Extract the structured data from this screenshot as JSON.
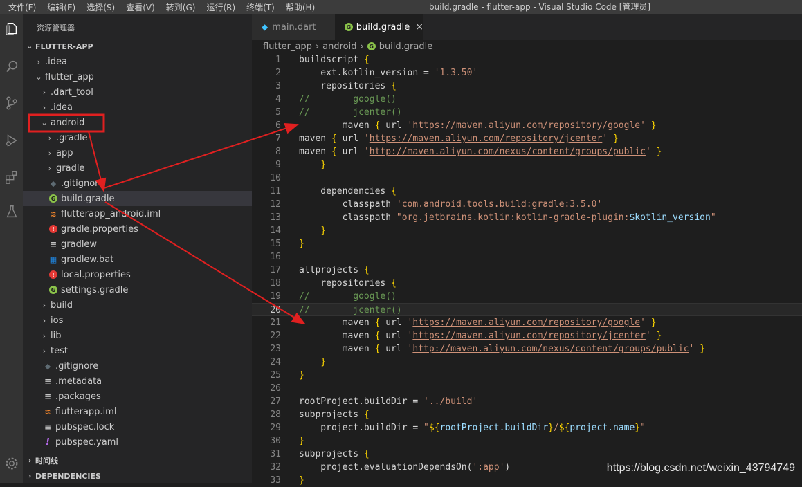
{
  "menu": [
    "文件(F)",
    "编辑(E)",
    "选择(S)",
    "查看(V)",
    "转到(G)",
    "运行(R)",
    "终端(T)",
    "帮助(H)"
  ],
  "window_title": "build.gradle - flutter-app - Visual Studio Code [管理员]",
  "sidebar": {
    "title": "资源管理器",
    "root": "FLUTTER-APP",
    "timeline": "时间线",
    "dependencies": "DEPENDENCIES",
    "tree": [
      {
        "label": ".idea",
        "type": "folder",
        "depth": 0,
        "chev": "›"
      },
      {
        "label": "flutter_app",
        "type": "folder",
        "depth": 0,
        "chev": "⌄"
      },
      {
        "label": ".dart_tool",
        "type": "folder",
        "depth": 1,
        "chev": "›"
      },
      {
        "label": ".idea",
        "type": "folder",
        "depth": 1,
        "chev": "›"
      },
      {
        "label": "android",
        "type": "folder",
        "depth": 1,
        "chev": "⌄"
      },
      {
        "label": ".gradle",
        "type": "folder",
        "depth": 2,
        "chev": "›"
      },
      {
        "label": "app",
        "type": "folder",
        "depth": 2,
        "chev": "›"
      },
      {
        "label": "gradle",
        "type": "folder",
        "depth": 2,
        "chev": "›"
      },
      {
        "label": ".gitignore",
        "type": "git",
        "depth": 2
      },
      {
        "label": "build.gradle",
        "type": "gradle",
        "depth": 2,
        "selected": true
      },
      {
        "label": "flutterapp_android.iml",
        "type": "xml",
        "depth": 2
      },
      {
        "label": "gradle.properties",
        "type": "prop",
        "depth": 2
      },
      {
        "label": "gradlew",
        "type": "lines",
        "depth": 2
      },
      {
        "label": "gradlew.bat",
        "type": "win",
        "depth": 2
      },
      {
        "label": "local.properties",
        "type": "prop",
        "depth": 2
      },
      {
        "label": "settings.gradle",
        "type": "gradle",
        "depth": 2
      },
      {
        "label": "build",
        "type": "folder",
        "depth": 1,
        "chev": "›"
      },
      {
        "label": "ios",
        "type": "folder",
        "depth": 1,
        "chev": "›"
      },
      {
        "label": "lib",
        "type": "folder",
        "depth": 1,
        "chev": "›"
      },
      {
        "label": "test",
        "type": "folder",
        "depth": 1,
        "chev": "›"
      },
      {
        "label": ".gitignore",
        "type": "git",
        "depth": 1
      },
      {
        "label": ".metadata",
        "type": "lines",
        "depth": 1
      },
      {
        "label": ".packages",
        "type": "lines",
        "depth": 1
      },
      {
        "label": "flutterapp.iml",
        "type": "xml",
        "depth": 1
      },
      {
        "label": "pubspec.lock",
        "type": "lines",
        "depth": 1
      },
      {
        "label": "pubspec.yaml",
        "type": "yaml",
        "depth": 1
      }
    ]
  },
  "tabs": [
    {
      "label": "main.dart",
      "active": false
    },
    {
      "label": "build.gradle",
      "active": true
    }
  ],
  "breadcrumb": [
    "flutter_app",
    "android",
    "build.gradle"
  ],
  "code_lines": [
    "buildscript {",
    "    ext.kotlin_version = '1.3.50'",
    "    repositories {",
    "//        google()",
    "//        jcenter()",
    "        maven { url 'https://maven.aliyun.com/repository/google' }",
    "maven { url 'https://maven.aliyun.com/repository/jcenter' }",
    "maven { url 'http://maven.aliyun.com/nexus/content/groups/public' }",
    "    }",
    "",
    "    dependencies {",
    "        classpath 'com.android.tools.build:gradle:3.5.0'",
    "        classpath \"org.jetbrains.kotlin:kotlin-gradle-plugin:$kotlin_version\"",
    "    }",
    "}",
    "",
    "allprojects {",
    "    repositories {",
    "//        google()",
    "//        jcenter()",
    "        maven { url 'https://maven.aliyun.com/repository/google' }",
    "        maven { url 'https://maven.aliyun.com/repository/jcenter' }",
    "        maven { url 'http://maven.aliyun.com/nexus/content/groups/public' }",
    "    }",
    "}",
    "",
    "rootProject.buildDir = '../build'",
    "subprojects {",
    "    project.buildDir = \"${rootProject.buildDir}/${project.name}\"",
    "}",
    "subprojects {",
    "    project.evaluationDependsOn(':app')",
    "}"
  ],
  "current_line": 20,
  "watermark": "https://blog.csdn.net/weixin_43794749",
  "colors": {
    "annotation_red": "#e02020",
    "accent": "#007acc"
  }
}
